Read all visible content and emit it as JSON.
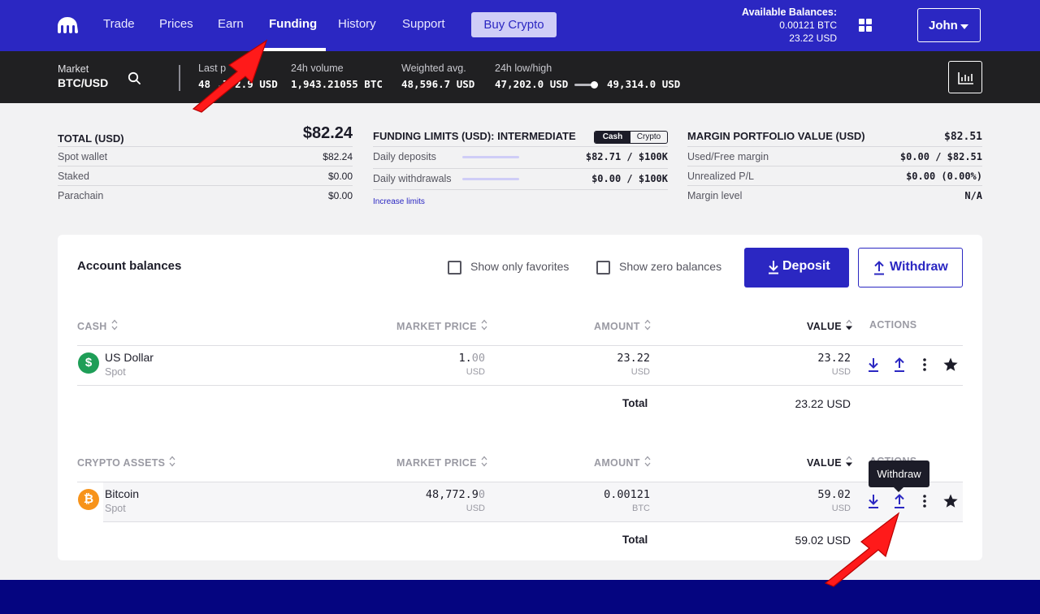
{
  "nav": {
    "items": [
      {
        "label": "Trade"
      },
      {
        "label": "Prices"
      },
      {
        "label": "Earn"
      },
      {
        "label": "Funding"
      },
      {
        "label": "History"
      },
      {
        "label": "Support"
      }
    ],
    "active": "Funding",
    "buy_crypto": "Buy Crypto",
    "available_title": "Available Balances:",
    "available_btc": "0.00121 BTC",
    "available_usd": "23.22 USD",
    "user": "John"
  },
  "ticker": {
    "market_label": "Market",
    "market_value": "BTC/USD",
    "last_price_label": "Last p",
    "last_price_value": "48 ,772.9 USD",
    "volume_label": "24h volume",
    "volume_value": "1,943.21055 BTC",
    "wavg_label": "Weighted avg.",
    "wavg_value": "48,596.7 USD",
    "lowhigh_label": "24h low/high",
    "low_value": "47,202.0 USD",
    "high_value": "49,314.0 USD"
  },
  "summary": {
    "total": {
      "title": "TOTAL (USD)",
      "value": "$82.24",
      "rows": [
        {
          "label": "Spot wallet",
          "value": "$82.24"
        },
        {
          "label": "Staked",
          "value": "$0.00"
        },
        {
          "label": "Parachain",
          "value": "$0.00"
        }
      ]
    },
    "funding": {
      "title": "FUNDING LIMITS (USD): INTERMEDIATE",
      "toggle_on": "Cash",
      "toggle_off": "Crypto",
      "rows": [
        {
          "label": "Daily deposits",
          "value": "$82.71 / $100K"
        },
        {
          "label": "Daily withdrawals",
          "value": "$0.00 / $100K"
        }
      ],
      "link": "Increase limits"
    },
    "margin": {
      "title": "MARGIN PORTFOLIO VALUE (USD)",
      "value": "$82.51",
      "rows": [
        {
          "label": "Used/Free margin",
          "value": "$0.00 / $82.51"
        },
        {
          "label": "Unrealized P/L",
          "value": "$0.00 (0.00%)"
        },
        {
          "label": "Margin level",
          "value": "N/A"
        }
      ]
    }
  },
  "balances": {
    "title": "Account balances",
    "show_favorites": "Show only favorites",
    "show_zero": "Show zero balances",
    "deposit": "Deposit",
    "withdraw": "Withdraw",
    "cash": {
      "headers": {
        "asset": "CASH",
        "price": "MARKET PRICE",
        "amount": "AMOUNT",
        "value": "VALUE",
        "actions": "ACTIONS"
      },
      "rows": [
        {
          "name": "US Dollar",
          "sub": "Spot",
          "price_main": "1.",
          "price_dim": "00",
          "price_unit": "USD",
          "amount": "23.22",
          "amount_unit": "USD",
          "value": "23.22",
          "value_unit": "USD"
        }
      ],
      "total_label": "Total",
      "total_value": "23.22 USD"
    },
    "crypto": {
      "headers": {
        "asset": "CRYPTO ASSETS",
        "price": "MARKET PRICE",
        "amount": "AMOUNT",
        "value": "VALUE",
        "actions": "ACTIONS"
      },
      "rows": [
        {
          "name": "Bitcoin",
          "sub": "Spot",
          "price_main": "48,772.9",
          "price_dim": "0",
          "price_unit": "USD",
          "amount": "0.00121",
          "amount_unit": "BTC",
          "value": "59.02",
          "value_unit": "USD"
        }
      ],
      "total_label": "Total",
      "total_value": "59.02 USD"
    },
    "tooltip": "Withdraw"
  },
  "colors": {
    "brand": "#2b27c2",
    "ticker_bg": "#202022",
    "usd_coin": "#1e9e57",
    "btc_coin": "#f7931a",
    "annotation_arrow": "#ff1a1a",
    "footer": "#050580"
  }
}
